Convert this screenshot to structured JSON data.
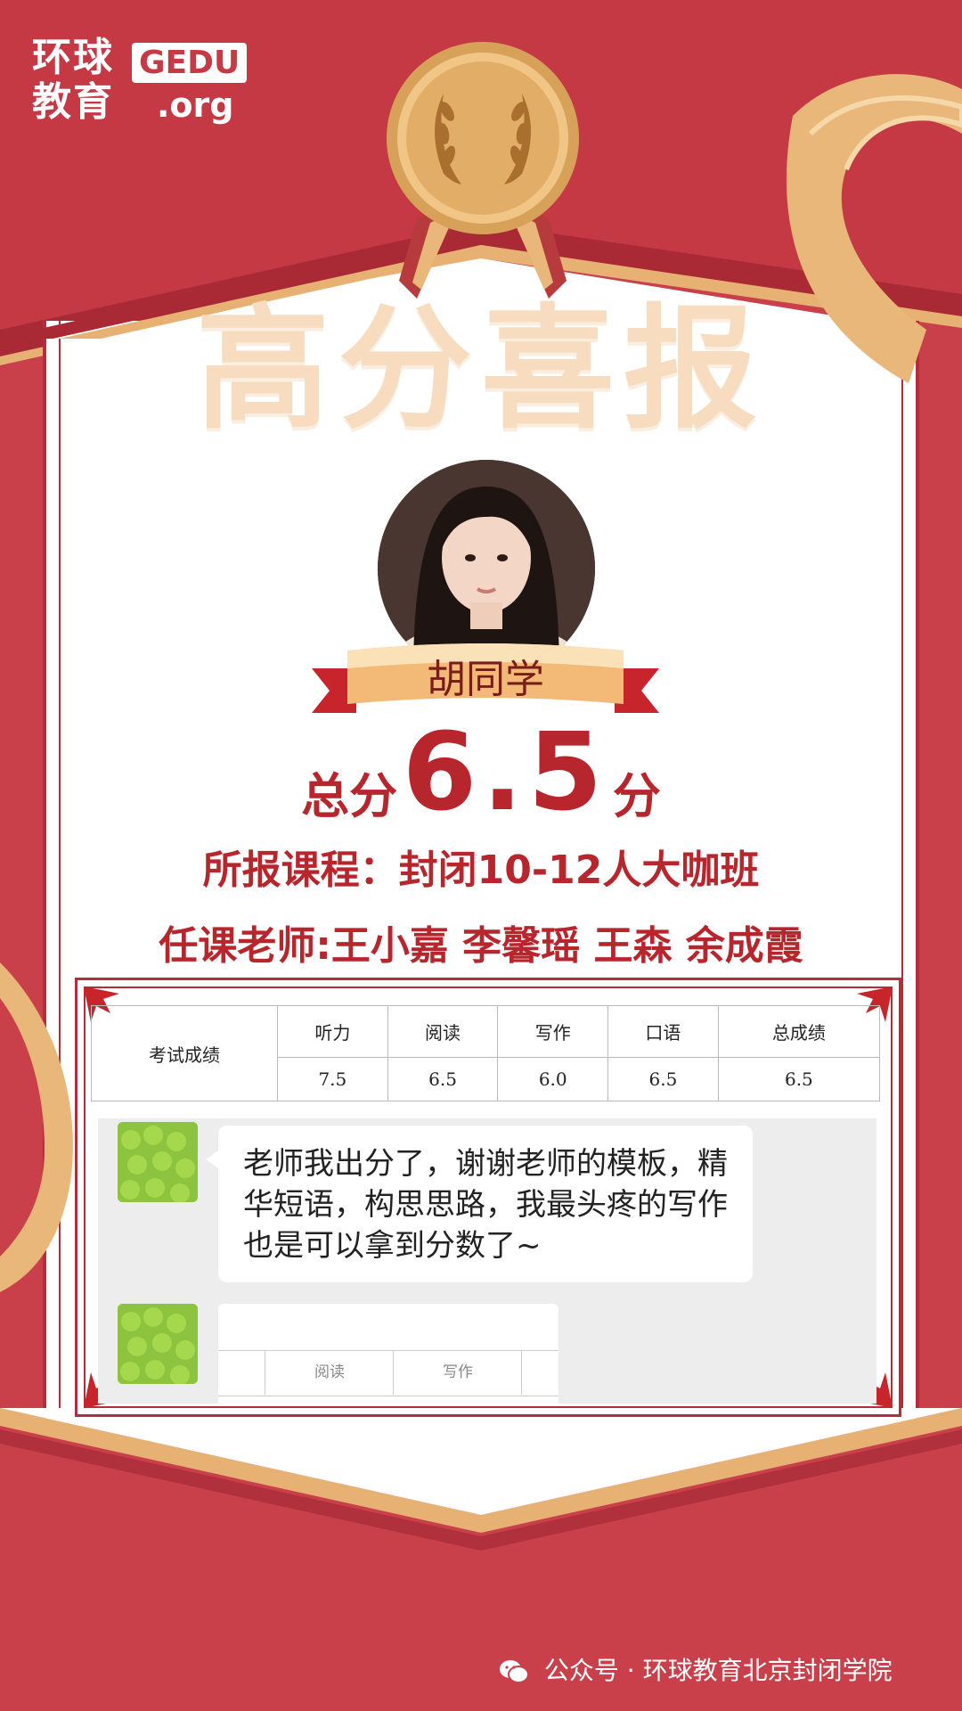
{
  "logo": {
    "line1": "环球",
    "line2": "教育",
    "badge": "GEDU",
    "suffix": ".org"
  },
  "title": "高分喜报",
  "student": {
    "name": "胡同学"
  },
  "score": {
    "prefix": "总分",
    "value": "6.5",
    "suffix": "分"
  },
  "course": "所报课程：封闭10-12人大咖班",
  "teachers": "任课老师:王小嘉 李馨瑶 王森 余成霞",
  "score_table": {
    "row_label": "考试成绩",
    "headers": [
      "听力",
      "阅读",
      "写作",
      "口语",
      "总成绩"
    ],
    "values": [
      "7.5",
      "6.5",
      "6.0",
      "6.5",
      "6.5"
    ]
  },
  "chat": {
    "message": "老师我出分了，谢谢老师的模板，精华短语，构思思路，我最头疼的写作也是可以拿到分数了~",
    "image_table_headers": [
      "阅读",
      "写作"
    ]
  },
  "footer": "公众号 · 环球教育北京封闭学院",
  "colors": {
    "brand_red": "#c63a45",
    "dark_red": "#b7262c",
    "gold": "#e9b77a",
    "title_cream": "#f7dcc0"
  }
}
